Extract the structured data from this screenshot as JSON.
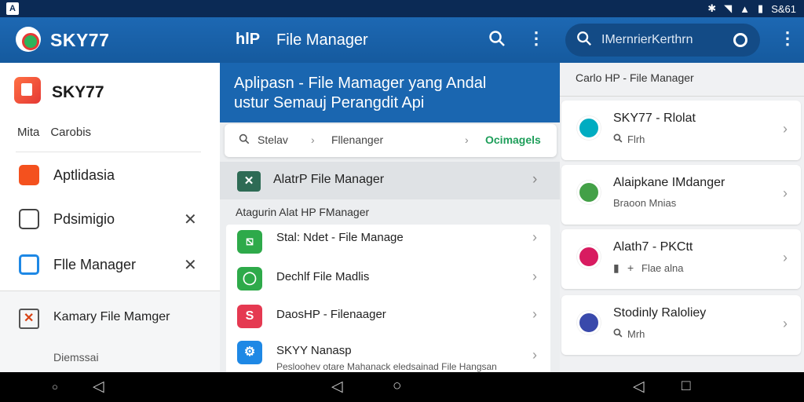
{
  "status_bar": {
    "left_icon": "A",
    "right_text": "S&61",
    "icons": [
      "bluetooth-icon",
      "wifi-icon",
      "signal-icon",
      "battery-icon"
    ]
  },
  "app_bar": {
    "app_title": "SKY77",
    "fm_prefix": "hlP",
    "fm_title": "File Manager",
    "search_text": "IMernrierKerthrn"
  },
  "left_panel": {
    "name": "SKY77",
    "sub": [
      "Mita",
      "Carobis"
    ],
    "nav": [
      {
        "label": "Aptlidasia",
        "color": "#f4511e",
        "closable": false
      },
      {
        "label": "Pdsimigio",
        "color": "#ffffff",
        "closable": true
      },
      {
        "label": "Flle Manager",
        "color": "#1e88e5",
        "closable": true
      }
    ],
    "bottom_label": "Kamary File Mamger",
    "bottom_sub": "Diemssai"
  },
  "middle_panel": {
    "banner_line1": "Aplipasn - File Mamager yang Andal",
    "banner_line2": "ustur Semauj Perangdit Api",
    "breadcrumb": [
      "Stelav",
      "Fllenanger",
      "Ocimagels"
    ],
    "alat_label": "AlatrP File Manager",
    "section_label": "Atagurin Alat HP FManager",
    "items": [
      {
        "label": "Stal: Ndet - File Manage",
        "color": "#2eaa4a",
        "glyph": "⧅",
        "sub": ""
      },
      {
        "label": "Dechlf File Madlis",
        "color": "#2eaa4a",
        "glyph": "◯",
        "sub": ""
      },
      {
        "label": "DaosHP - Filenaager",
        "color": "#e53951",
        "glyph": "S",
        "sub": ""
      },
      {
        "label": "SKYY Nanasp",
        "color": "#1e88e5",
        "glyph": "⚙",
        "sub": "Pesloohev otare Mahanack eledsainad File Hangsan"
      }
    ]
  },
  "right_panel": {
    "header": "Carlo HP - File Manager",
    "cards": [
      {
        "title": "SKY77 - Rlolat",
        "sub": "Flrh",
        "color": "#00acc1",
        "sub_icon": "search"
      },
      {
        "title": "Alaipkane IMdanger",
        "sub": "Braoon Mnias",
        "color": "#43a047",
        "sub_icon": "none"
      },
      {
        "title": "Alath7 - PKCtt",
        "sub": "Flae  alna",
        "color": "#d81b60",
        "sub_icon": "bookmark"
      },
      {
        "title": "Stodinly Raloliey",
        "sub": "Mrh",
        "color": "#3949ab",
        "sub_icon": "search"
      }
    ]
  },
  "colors": {
    "app_bar": "#1d68b3",
    "status_bar": "#0b2a55",
    "accent_green": "#1e9e5a"
  }
}
